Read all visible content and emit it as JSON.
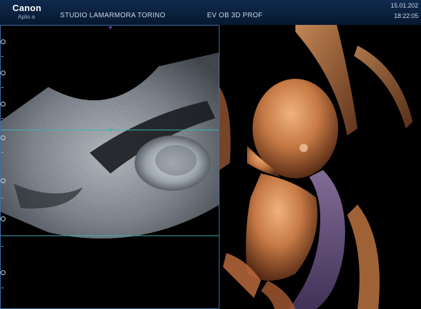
{
  "header": {
    "brand": "Canon",
    "model": "Aplio a",
    "studio": "STUDIO LAMARMORA TORINO",
    "preset": "EV OB 3D PROF",
    "date": "15.01.202",
    "time": "18:22:05"
  },
  "colors": {
    "header_bg": "#0f2a4d",
    "frame_border": "#3f6fa8",
    "cursor_line": "#3fb4b0",
    "marker": "#6a34a8",
    "render_tone": "#c77a45"
  }
}
